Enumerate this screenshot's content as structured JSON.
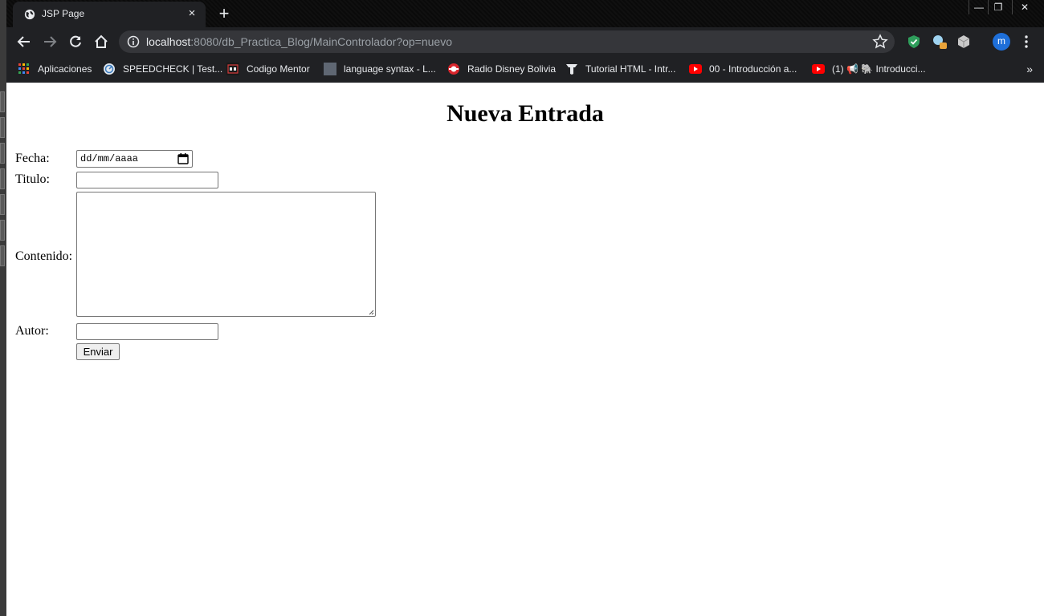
{
  "browser": {
    "tab_title": "JSP Page",
    "tab_close": "×",
    "new_tab": "+",
    "url_host": "localhost",
    "url_rest": ":8080/db_Practica_Blog/MainControlador?op=nuevo",
    "avatar_letter": "m",
    "window_controls": {
      "minimize": "—",
      "restore": "❐",
      "close": "✕"
    }
  },
  "bookmarks": {
    "items": [
      {
        "label": "Aplicaciones",
        "icon": "apps-grid-icon"
      },
      {
        "label": "SPEEDCHECK | Test...",
        "icon": "speedcheck-icon"
      },
      {
        "label": "Codigo Mentor",
        "icon": "codigo-mentor-icon"
      },
      {
        "label": "language syntax - L...",
        "icon": "page-icon"
      },
      {
        "label": "Radio Disney Bolivia",
        "icon": "radio-icon"
      },
      {
        "label": "Tutorial HTML - Intr...",
        "icon": "tutorial-icon"
      },
      {
        "label": "00 - Introducción a...",
        "icon": "youtube-icon"
      },
      {
        "label": "(1) 📢 🐘 Introducci...",
        "icon": "youtube-icon"
      }
    ],
    "more": "»"
  },
  "page": {
    "heading": "Nueva Entrada",
    "form": {
      "fecha_label": "Fecha:",
      "fecha_placeholder": "dd/mm/aaaa",
      "titulo_label": "Titulo:",
      "contenido_label": "Contenido:",
      "autor_label": "Autor:",
      "submit_label": "Enviar"
    }
  }
}
